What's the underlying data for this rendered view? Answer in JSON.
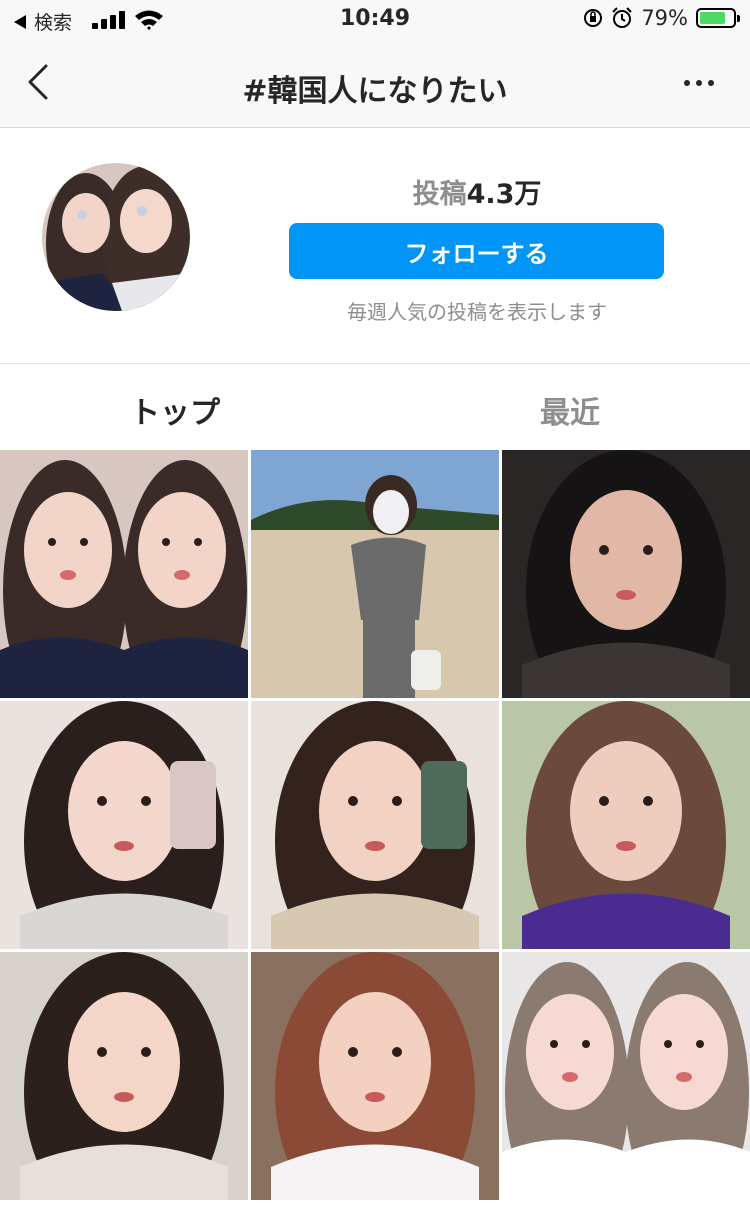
{
  "status_bar": {
    "back_app": "検索",
    "time": "10:49",
    "battery_percent": "79%",
    "battery_level": 0.79,
    "signal_bars": 4
  },
  "nav": {
    "title": "#韓国人になりたい",
    "back_icon": "chevron-left-icon",
    "more_icon": "more-horizontal-icon"
  },
  "header": {
    "posts_label": "投稿",
    "posts_count": "4.3万",
    "follow_label": "フォローする",
    "hint": "毎週人気の投稿を表示します"
  },
  "tabs": [
    {
      "label": "トップ",
      "active": true
    },
    {
      "label": "最近",
      "active": false
    }
  ],
  "colors": {
    "accent": "#0095f6",
    "text_primary": "#262626",
    "text_secondary": "#8e8e8e",
    "battery": "#4cd964"
  },
  "grid": {
    "columns": 3,
    "tiles": [
      {
        "kind": "two-girls-selfie-filter",
        "palette": [
          "#d8c7c0",
          "#3a2b28",
          "#f2d5c8",
          "#1e2340"
        ]
      },
      {
        "kind": "girl-on-beach",
        "palette": [
          "#7fa6d3",
          "#d6c7ad",
          "#f0f0f2",
          "#6b6b6b"
        ]
      },
      {
        "kind": "boy-in-car-dark",
        "palette": [
          "#2a2625",
          "#151313",
          "#e0b8a5",
          "#3b3534"
        ]
      },
      {
        "kind": "girl-mirror-selfie-white-hood",
        "palette": [
          "#e9e2df",
          "#2a1f1d",
          "#f3d7cc",
          "#d9d6d6"
        ]
      },
      {
        "kind": "girl-phone-green-case",
        "palette": [
          "#e8e1dc",
          "#33231c",
          "#f1d2c3",
          "#d7c9b1"
        ]
      },
      {
        "kind": "girl-purple-top",
        "palette": [
          "#b9c7a7",
          "#6b4a3d",
          "#efcdbe",
          "#4a2b8f"
        ]
      },
      {
        "kind": "girl-long-hair-closeup",
        "palette": [
          "#d7d1cc",
          "#2c201c",
          "#f4d6c8",
          "#e7dfda"
        ]
      },
      {
        "kind": "girl-cat-filter-choker",
        "palette": [
          "#8a705e",
          "#8a4a36",
          "#f3d0c0",
          "#f5f3f3"
        ]
      },
      {
        "kind": "two-girls-bob-hair",
        "palette": [
          "#e9e6e8",
          "#8a7a6f",
          "#f6d9d2",
          "#ffffff"
        ]
      }
    ]
  }
}
